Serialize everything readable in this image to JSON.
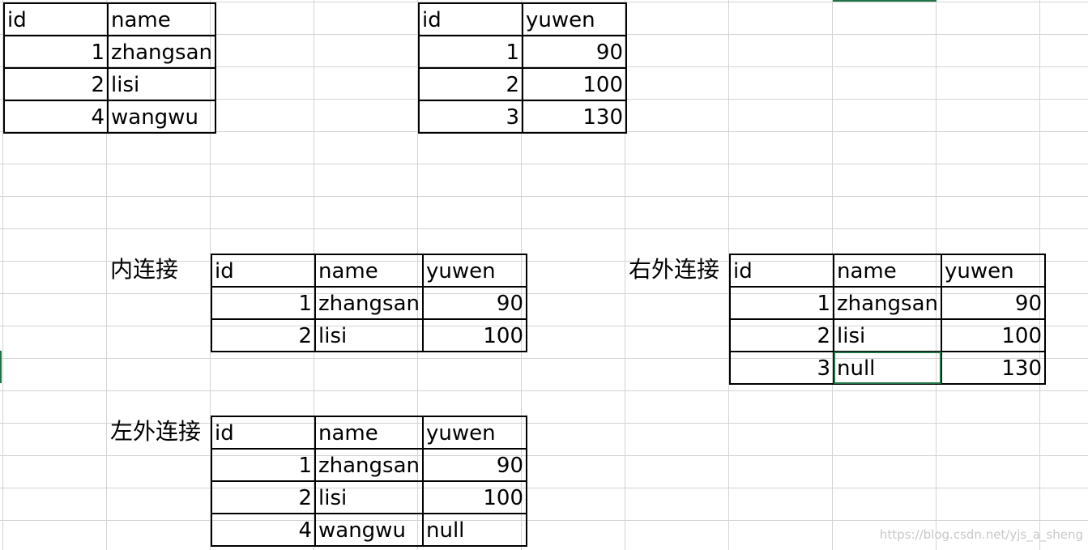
{
  "tables": {
    "students": {
      "header": [
        "id",
        "name"
      ],
      "rows": [
        [
          "1",
          "zhangsan"
        ],
        [
          "2",
          "lisi"
        ],
        [
          "4",
          "wangwu"
        ]
      ]
    },
    "scores": {
      "header": [
        "id",
        "yuwen"
      ],
      "rows": [
        [
          "1",
          "90"
        ],
        [
          "2",
          "100"
        ],
        [
          "3",
          "130"
        ]
      ]
    },
    "inner_join": {
      "label": "内连接",
      "header": [
        "id",
        "name",
        "yuwen"
      ],
      "rows": [
        [
          "1",
          "zhangsan",
          "90"
        ],
        [
          "2",
          "lisi",
          "100"
        ]
      ]
    },
    "right_join": {
      "label": "右外连接",
      "header": [
        "id",
        "name",
        "yuwen"
      ],
      "rows": [
        [
          "1",
          "zhangsan",
          "90"
        ],
        [
          "2",
          "lisi",
          "100"
        ],
        [
          "3",
          "null",
          "130"
        ]
      ]
    },
    "left_join": {
      "label": "左外连接",
      "header": [
        "id",
        "name",
        "yuwen"
      ],
      "rows": [
        [
          "1",
          "zhangsan",
          "90"
        ],
        [
          "2",
          "lisi",
          "100"
        ],
        [
          "4",
          "wangwu",
          "null"
        ]
      ]
    }
  },
  "watermark": "https://blog.csdn.net/yjs_a_sheng",
  "colors": {
    "gridline": "#d4d4d4",
    "border": "#000000",
    "selection": "#217346",
    "watermark": "#c8c8c8"
  }
}
